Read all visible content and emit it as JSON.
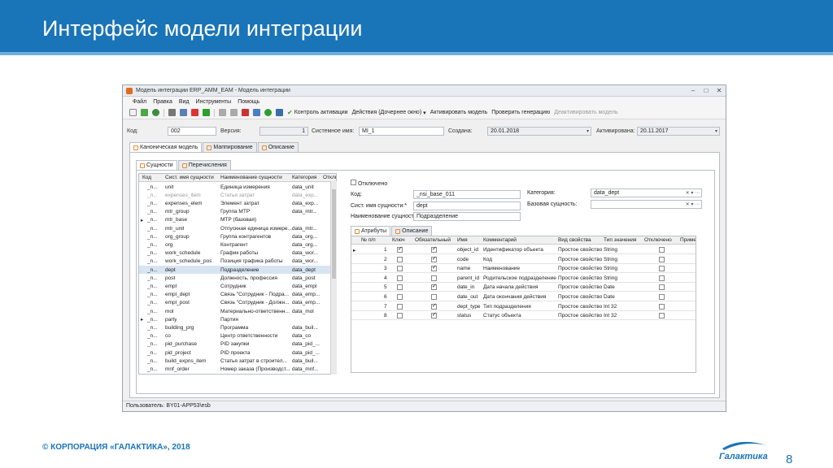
{
  "slide": {
    "title": "Интерфейс модели интеграции",
    "copyright": "© КОРПОРАЦИЯ «ГАЛАКТИКА», 2018",
    "page_number": "8",
    "logo_text": "Галактика",
    "colors": {
      "banner": "#1a74b8",
      "accent": "#6fb0de"
    }
  },
  "window": {
    "title": "Модель интеграции ERP_AMM_EAM - Модель интеграции",
    "menu": [
      "Файл",
      "Правка",
      "Вид",
      "Инструменты",
      "Помощь"
    ],
    "toolbar": {
      "control_activation": "Контроль активации",
      "actions": "Действия (Дочернее окно)",
      "activate": "Активировать модель",
      "check_generation": "Проверить генерацию",
      "deactivate": "Деактивировать модель"
    },
    "header": {
      "code_label": "Код:",
      "code_value": "002",
      "version_label": "Версия:",
      "version_value": "1",
      "sysname_label": "Системное имя:",
      "sysname_value": "MI_1",
      "created_label": "Создана:",
      "created_value": "20.01.2018",
      "activated_label": "Активирована:",
      "activated_value": "20.11.2017"
    },
    "top_tabs": [
      "Каноническая модель",
      "Маппирование",
      "Описание"
    ],
    "sub_tabs": [
      "Сущности",
      "Перечисления"
    ],
    "entity_grid": {
      "columns": [
        "Код",
        "Сист. имя сущности",
        "Наименование сущности",
        "Категория",
        "Отклю"
      ],
      "rows": [
        {
          "code": "_n...",
          "sys": "unit",
          "name": "Единица измерения",
          "cat": "data_unit",
          "muted": false,
          "expand": false
        },
        {
          "code": "_n...",
          "sys": "expenses_item",
          "name": "Статья затрат",
          "cat": "data_exp...",
          "muted": true,
          "expand": false
        },
        {
          "code": "_n...",
          "sys": "expenses_elem",
          "name": "Элемент затрат",
          "cat": "data_exp...",
          "muted": false,
          "expand": false
        },
        {
          "code": "_n...",
          "sys": "mtr_group",
          "name": "Группа МТР",
          "cat": "data_mtr...",
          "muted": false,
          "expand": false
        },
        {
          "code": "_n...",
          "sys": "mtr_base",
          "name": "МТР (базовая)",
          "cat": "",
          "muted": false,
          "expand": true
        },
        {
          "code": "_n...",
          "sys": "mtr_unit",
          "name": "Отпускная единица измере...",
          "cat": "data_mtr...",
          "muted": false,
          "expand": false
        },
        {
          "code": "_n...",
          "sys": "org_group",
          "name": "Группа контрагентов",
          "cat": "data_org...",
          "muted": false,
          "expand": false
        },
        {
          "code": "_n...",
          "sys": "org",
          "name": "Контрагент",
          "cat": "data_org...",
          "muted": false,
          "expand": false
        },
        {
          "code": "_n...",
          "sys": "work_schedule",
          "name": "График работы",
          "cat": "data_wor...",
          "muted": false,
          "expand": false
        },
        {
          "code": "_n...",
          "sys": "work_schedule_pos",
          "name": "Позиция графика работы",
          "cat": "data_wor...",
          "muted": false,
          "expand": false
        },
        {
          "code": "_n...",
          "sys": "dept",
          "name": "Подразделение",
          "cat": "data_dept",
          "muted": false,
          "expand": false,
          "selected": true
        },
        {
          "code": "_n...",
          "sys": "post",
          "name": "Должность, профессия",
          "cat": "data_post",
          "muted": false,
          "expand": false
        },
        {
          "code": "_n...",
          "sys": "empl",
          "name": "Сотрудник",
          "cat": "data_empl",
          "muted": false,
          "expand": false
        },
        {
          "code": "_n...",
          "sys": "empl_dept",
          "name": "Связь \"Сотрудник - Подра...",
          "cat": "data_emp...",
          "muted": false,
          "expand": false
        },
        {
          "code": "_n...",
          "sys": "empl_post",
          "name": "Связь \"Сотрудник - Должн...",
          "cat": "data_emp...",
          "muted": false,
          "expand": false
        },
        {
          "code": "_n...",
          "sys": "mol",
          "name": "Материально-ответственн...",
          "cat": "data_mol",
          "muted": false,
          "expand": false
        },
        {
          "code": "_n...",
          "sys": "party",
          "name": "Партия",
          "cat": "",
          "muted": false,
          "expand": true
        },
        {
          "code": "_n...",
          "sys": "building_prg",
          "name": "Программа",
          "cat": "data_buil...",
          "muted": false,
          "expand": false
        },
        {
          "code": "_n...",
          "sys": "co",
          "name": "Центр ответственности",
          "cat": "data_co",
          "muted": false,
          "expand": false
        },
        {
          "code": "_n...",
          "sys": "pid_purchase",
          "name": "PID закупки",
          "cat": "data_pid_...",
          "muted": false,
          "expand": false
        },
        {
          "code": "_n...",
          "sys": "pid_project",
          "name": "PID проекта",
          "cat": "data_pid_...",
          "muted": false,
          "expand": false
        },
        {
          "code": "_n...",
          "sys": "build_expns_item",
          "name": "Статья затрат в строител...",
          "cat": "data_buil...",
          "muted": false,
          "expand": false
        },
        {
          "code": "_n...",
          "sys": "mnf_order",
          "name": "Номер заказа (Производст...",
          "cat": "data_mnf...",
          "muted": false,
          "expand": false
        }
      ]
    },
    "detail": {
      "disabled_label": "Отключено",
      "code_label": "Код:",
      "code_value": "_nsi_base_011",
      "sysname_label": "Сист. имя сущности:*",
      "sysname_value": "dept",
      "name_label": "Наименование сущности:*",
      "name_value": "Подразделение",
      "category_label": "Категория:",
      "category_value": "data_dept",
      "base_label": "Базовая сущность:",
      "base_value": ""
    },
    "attr_tabs": [
      "Атрибуты",
      "Описание"
    ],
    "attr_grid": {
      "columns": [
        "№ п/п",
        "Ключ",
        "Обязательный",
        "Имя",
        "Комментарий",
        "Вид свойства",
        "Тип значения",
        "Отключено",
        "Пример"
      ],
      "rows": [
        {
          "n": "1",
          "key": true,
          "req": true,
          "name": "object_id",
          "comment": "Идентификатор объекта",
          "kind": "Простое свойство",
          "type": "String",
          "off": false
        },
        {
          "n": "2",
          "key": false,
          "req": true,
          "name": "code",
          "comment": "Код",
          "kind": "Простое свойство",
          "type": "String",
          "off": false
        },
        {
          "n": "3",
          "key": false,
          "req": true,
          "name": "name",
          "comment": "Наименование",
          "kind": "Простое свойство",
          "type": "String",
          "off": false
        },
        {
          "n": "4",
          "key": false,
          "req": false,
          "name": "parent_id",
          "comment": "Родительское подразделение",
          "kind": "Простое свойство",
          "type": "String",
          "off": false
        },
        {
          "n": "5",
          "key": false,
          "req": true,
          "name": "date_in",
          "comment": "Дата начала действия",
          "kind": "Простое свойство",
          "type": "Date",
          "off": false
        },
        {
          "n": "6",
          "key": false,
          "req": false,
          "name": "date_out",
          "comment": "Дата окончания действия",
          "kind": "Простое свойство",
          "type": "Date",
          "off": false
        },
        {
          "n": "7",
          "key": false,
          "req": true,
          "name": "dept_type",
          "comment": "Тип подразделения",
          "kind": "Простое свойство",
          "type": "Int 32",
          "off": false
        },
        {
          "n": "8",
          "key": false,
          "req": true,
          "name": "status",
          "comment": "Статус объекта",
          "kind": "Простое свойство",
          "type": "Int 32",
          "off": false
        }
      ]
    },
    "status": "Пользователь: BY01-APP53\\esb"
  }
}
